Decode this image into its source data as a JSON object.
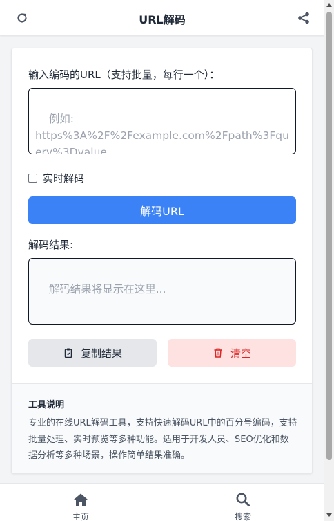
{
  "header": {
    "title": "URL解码",
    "left_icon": "refresh-icon",
    "right_icon": "share-icon"
  },
  "decoder": {
    "input_label": "输入编码的URL（支持批量，每行一个）：",
    "input_placeholder": "例如:\nhttps%3A%2F%2Fexample.com%2Fpath%3Fquery%3Dvalue",
    "input_value": "",
    "realtime_label": "实时解码",
    "realtime_checked": false,
    "decode_button": "解码URL",
    "result_label": "解码结果:",
    "result_placeholder": "解码结果将显示在这里...",
    "result_value": "",
    "copy_button": "复制结果",
    "clear_button": "清空"
  },
  "info": {
    "title": "工具说明",
    "text": "专业的在线URL解码工具，支持快速解码URL中的百分号编码，支持批量处理、实时预览等多种功能。适用于开发人员、SEO优化和数据分析等多种场景，操作简单结果准确。"
  },
  "tabbar": {
    "items": [
      {
        "label": "主页",
        "icon": "home-icon"
      },
      {
        "label": "搜索",
        "icon": "search-icon"
      }
    ]
  },
  "colors": {
    "primary": "#3b82f6",
    "danger": "#dc2626",
    "danger_bg": "#fee2e2",
    "neutral_bg": "#e5e7eb"
  }
}
